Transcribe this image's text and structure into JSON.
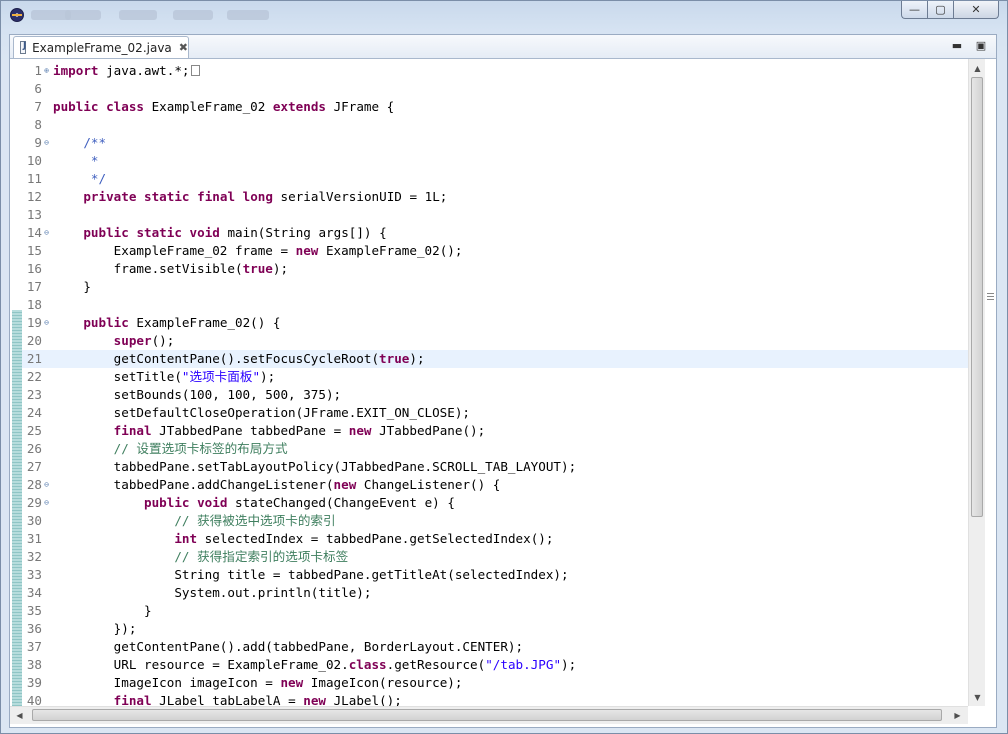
{
  "editor": {
    "tab_title": "ExampleFrame_02.java",
    "icons": {
      "app": "eclipse-icon",
      "file": "java-file-icon",
      "tab_close": "close-icon",
      "minimize": "minimize-icon",
      "maximize": "maximize-icon"
    },
    "highlighted_line": 21,
    "changed_line_range": [
      19,
      40
    ]
  },
  "window": {
    "min_glyph": "—",
    "max_glyph": "▢",
    "close_glyph": "✕"
  },
  "code_lines": [
    {
      "num": "1",
      "fold": "plus",
      "segs": [
        [
          "kw",
          "import"
        ],
        [
          "p",
          " java.awt.*;"
        ]
      ],
      "folded_box": true
    },
    {
      "num": "6",
      "segs": []
    },
    {
      "num": "7",
      "segs": [
        [
          "kw",
          "public"
        ],
        [
          "p",
          " "
        ],
        [
          "kw",
          "class"
        ],
        [
          "p",
          " ExampleFrame_02 "
        ],
        [
          "kw",
          "extends"
        ],
        [
          "p",
          " JFrame {"
        ]
      ]
    },
    {
      "num": "8",
      "segs": []
    },
    {
      "num": "9",
      "fold": "minus",
      "segs": [
        [
          "p",
          "    "
        ],
        [
          "cm",
          "/**"
        ]
      ]
    },
    {
      "num": "10",
      "segs": [
        [
          "p",
          "     "
        ],
        [
          "cm",
          "*"
        ]
      ]
    },
    {
      "num": "11",
      "segs": [
        [
          "p",
          "     "
        ],
        [
          "cm",
          "*/"
        ]
      ]
    },
    {
      "num": "12",
      "segs": [
        [
          "p",
          "    "
        ],
        [
          "kw",
          "private"
        ],
        [
          "p",
          " "
        ],
        [
          "kw",
          "static"
        ],
        [
          "p",
          " "
        ],
        [
          "kw",
          "final"
        ],
        [
          "p",
          " "
        ],
        [
          "kw",
          "long"
        ],
        [
          "p",
          " serialVersionUID = 1L;"
        ]
      ]
    },
    {
      "num": "13",
      "segs": []
    },
    {
      "num": "14",
      "fold": "minus",
      "segs": [
        [
          "p",
          "    "
        ],
        [
          "kw",
          "public"
        ],
        [
          "p",
          " "
        ],
        [
          "kw",
          "static"
        ],
        [
          "p",
          " "
        ],
        [
          "kw",
          "void"
        ],
        [
          "p",
          " main(String args[]) {"
        ]
      ]
    },
    {
      "num": "15",
      "segs": [
        [
          "p",
          "        ExampleFrame_02 frame = "
        ],
        [
          "kw",
          "new"
        ],
        [
          "p",
          " ExampleFrame_02();"
        ]
      ]
    },
    {
      "num": "16",
      "segs": [
        [
          "p",
          "        frame.setVisible("
        ],
        [
          "kw",
          "true"
        ],
        [
          "p",
          ");"
        ]
      ]
    },
    {
      "num": "17",
      "segs": [
        [
          "p",
          "    }"
        ]
      ]
    },
    {
      "num": "18",
      "segs": []
    },
    {
      "num": "19",
      "fold": "minus",
      "segs": [
        [
          "p",
          "    "
        ],
        [
          "kw",
          "public"
        ],
        [
          "p",
          " ExampleFrame_02() {"
        ]
      ]
    },
    {
      "num": "20",
      "segs": [
        [
          "p",
          "        "
        ],
        [
          "kw",
          "super"
        ],
        [
          "p",
          "();"
        ]
      ]
    },
    {
      "num": "21",
      "segs": [
        [
          "p",
          "        getContentPane().setFocusCycleRoot("
        ],
        [
          "kw",
          "true"
        ],
        [
          "p",
          ");"
        ]
      ]
    },
    {
      "num": "22",
      "segs": [
        [
          "p",
          "        setTitle("
        ],
        [
          "str",
          "\"选项卡面板\""
        ],
        [
          "p",
          ");"
        ]
      ]
    },
    {
      "num": "23",
      "segs": [
        [
          "p",
          "        setBounds(100, 100, 500, 375);"
        ]
      ]
    },
    {
      "num": "24",
      "segs": [
        [
          "p",
          "        setDefaultCloseOperation(JFrame.EXIT_ON_CLOSE);"
        ]
      ]
    },
    {
      "num": "25",
      "segs": [
        [
          "p",
          "        "
        ],
        [
          "kw",
          "final"
        ],
        [
          "p",
          " JTabbedPane tabbedPane = "
        ],
        [
          "kw",
          "new"
        ],
        [
          "p",
          " JTabbedPane();"
        ]
      ]
    },
    {
      "num": "26",
      "segs": [
        [
          "p",
          "        "
        ],
        [
          "cml",
          "// 设置选项卡标签的布局方式"
        ]
      ]
    },
    {
      "num": "27",
      "segs": [
        [
          "p",
          "        tabbedPane.setTabLayoutPolicy(JTabbedPane.SCROLL_TAB_LAYOUT);"
        ]
      ]
    },
    {
      "num": "28",
      "fold": "minus",
      "segs": [
        [
          "p",
          "        tabbedPane.addChangeListener("
        ],
        [
          "kw",
          "new"
        ],
        [
          "p",
          " ChangeListener() {"
        ]
      ]
    },
    {
      "num": "29",
      "fold": "minus",
      "segs": [
        [
          "p",
          "            "
        ],
        [
          "kw",
          "public"
        ],
        [
          "p",
          " "
        ],
        [
          "kw",
          "void"
        ],
        [
          "p",
          " stateChanged(ChangeEvent e) {"
        ]
      ]
    },
    {
      "num": "30",
      "segs": [
        [
          "p",
          "                "
        ],
        [
          "cml",
          "// 获得被选中选项卡的索引"
        ]
      ]
    },
    {
      "num": "31",
      "segs": [
        [
          "p",
          "                "
        ],
        [
          "kw",
          "int"
        ],
        [
          "p",
          " selectedIndex = tabbedPane.getSelectedIndex();"
        ]
      ]
    },
    {
      "num": "32",
      "segs": [
        [
          "p",
          "                "
        ],
        [
          "cml",
          "// 获得指定索引的选项卡标签"
        ]
      ]
    },
    {
      "num": "33",
      "segs": [
        [
          "p",
          "                String title = tabbedPane.getTitleAt(selectedIndex);"
        ]
      ]
    },
    {
      "num": "34",
      "segs": [
        [
          "p",
          "                System.out.println(title);"
        ]
      ]
    },
    {
      "num": "35",
      "segs": [
        [
          "p",
          "            }"
        ]
      ]
    },
    {
      "num": "36",
      "segs": [
        [
          "p",
          "        });"
        ]
      ]
    },
    {
      "num": "37",
      "segs": [
        [
          "p",
          "        getContentPane().add(tabbedPane, BorderLayout.CENTER);"
        ]
      ]
    },
    {
      "num": "38",
      "segs": [
        [
          "p",
          "        URL resource = ExampleFrame_02."
        ],
        [
          "kw",
          "class"
        ],
        [
          "p",
          ".getResource("
        ],
        [
          "str",
          "\"/tab.JPG\""
        ],
        [
          "p",
          ");"
        ]
      ]
    },
    {
      "num": "39",
      "segs": [
        [
          "p",
          "        ImageIcon imageIcon = "
        ],
        [
          "kw",
          "new"
        ],
        [
          "p",
          " ImageIcon(resource);"
        ]
      ]
    },
    {
      "num": "40",
      "segs": [
        [
          "p",
          "        "
        ],
        [
          "kw",
          "final"
        ],
        [
          "p",
          " JLabel tabLabelA = "
        ],
        [
          "kw",
          "new"
        ],
        [
          "p",
          " JLabel();"
        ]
      ]
    }
  ]
}
